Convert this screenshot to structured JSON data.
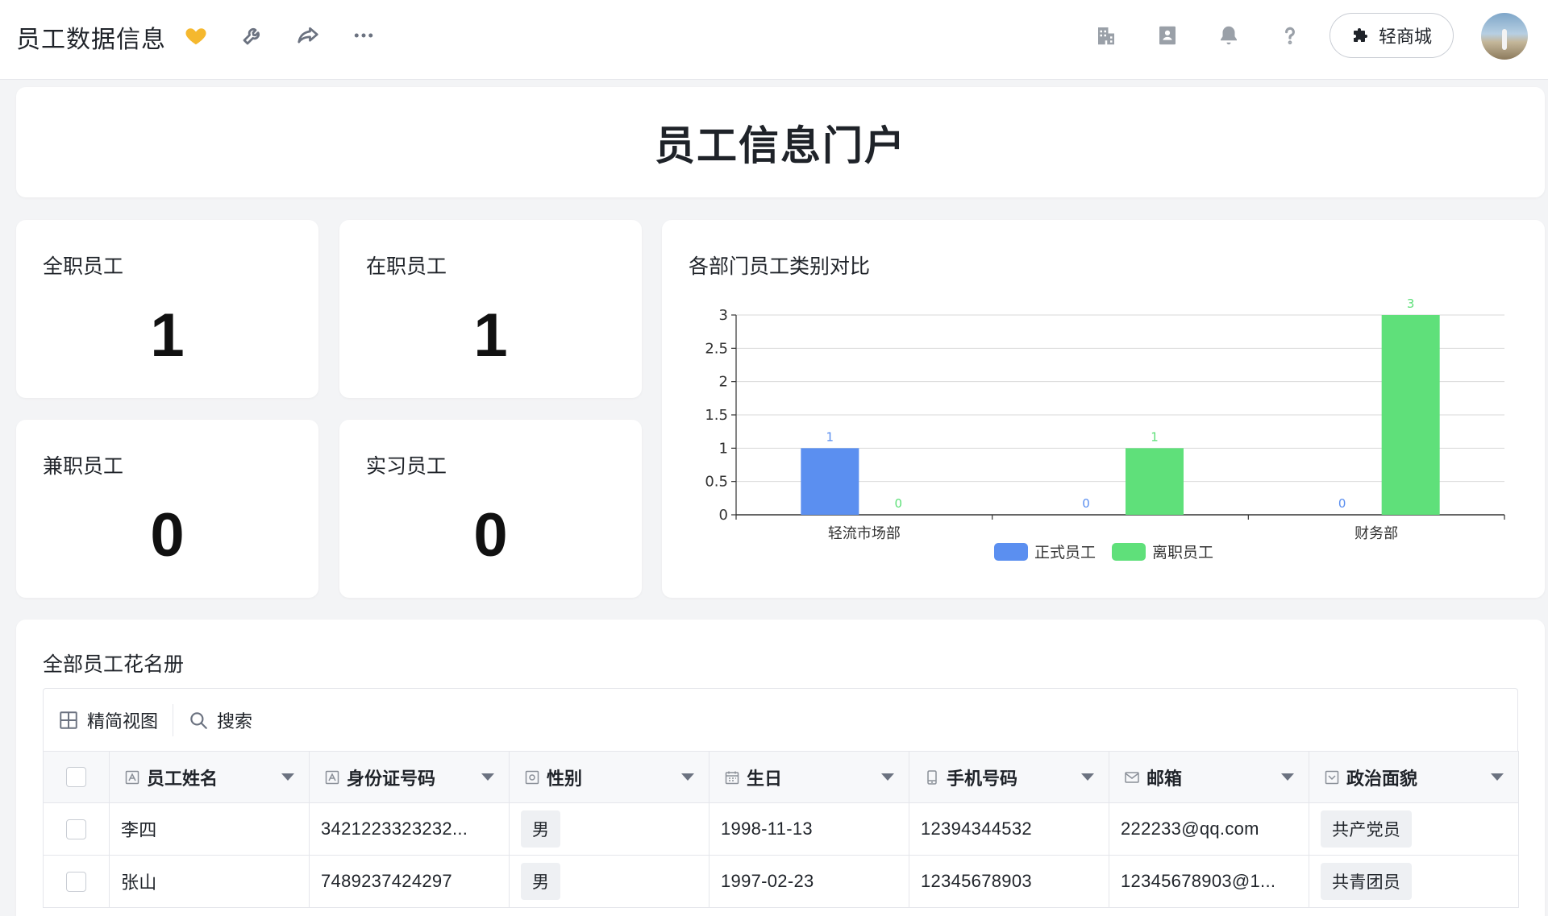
{
  "app": {
    "title": "员工数据信息"
  },
  "header": {
    "mall_label": "轻商城"
  },
  "banner": {
    "title": "员工信息门户"
  },
  "stats": [
    {
      "label": "全职员工",
      "value": "1"
    },
    {
      "label": "在职员工",
      "value": "1"
    },
    {
      "label": "兼职员工",
      "value": "0"
    },
    {
      "label": "实习员工",
      "value": "0"
    }
  ],
  "chart": {
    "title": "各部门员工类别对比"
  },
  "chart_data": {
    "type": "bar",
    "title": "各部门员工类别对比",
    "categories": [
      "轻流市场部",
      "",
      "财务部"
    ],
    "series": [
      {
        "name": "正式员工",
        "values": [
          1,
          0,
          0
        ],
        "color": "#5b8ff0"
      },
      {
        "name": "离职员工",
        "values": [
          0,
          1,
          3
        ],
        "color": "#5fe07a"
      }
    ],
    "ylim": [
      0,
      3
    ],
    "yticks": [
      "0",
      "0.5",
      "1",
      "1.5",
      "2",
      "2.5",
      "3"
    ],
    "grid": true,
    "legend": "bottom"
  },
  "roster": {
    "title": "全部员工花名册",
    "toolbar": {
      "view_label": "精简视图",
      "search_label": "搜索"
    },
    "columns": [
      "员工姓名",
      "身份证号码",
      "性别",
      "生日",
      "手机号码",
      "邮箱",
      "政治面貌"
    ],
    "rows": [
      {
        "name": "李四",
        "id_number": "3421223323232...",
        "gender": "男",
        "birthday": "1998-11-13",
        "phone": "12394344532",
        "email": "222233@qq.com",
        "political": "共产党员"
      },
      {
        "name": "张山",
        "id_number": "7489237424297",
        "gender": "男",
        "birthday": "1997-02-23",
        "phone": "12345678903",
        "email": "12345678903@1...",
        "political": "共青团员"
      }
    ]
  },
  "colors": {
    "accent_gold": "#f5b82e",
    "bar_blue": "#5b8ff0",
    "bar_green": "#5fe07a"
  }
}
